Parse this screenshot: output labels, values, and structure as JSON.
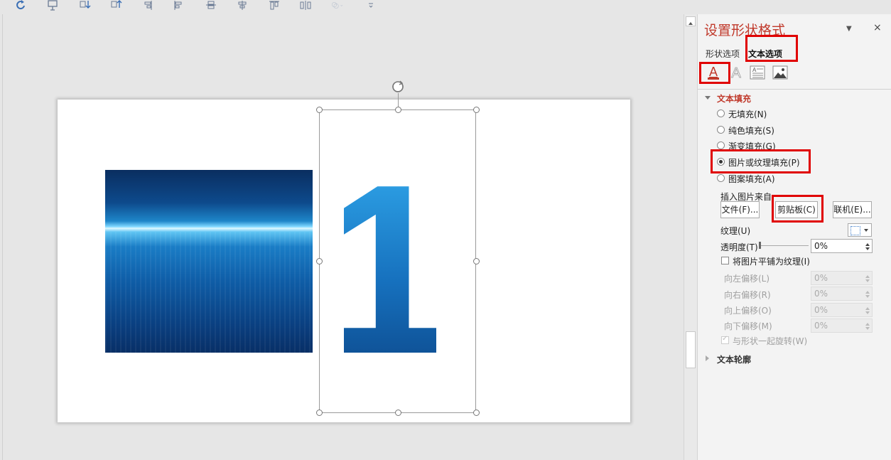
{
  "pane": {
    "title": "设置形状格式",
    "close_glyph": "×",
    "tabs": [
      "形状选项",
      "文本选项"
    ],
    "section_fill": "文本填充",
    "section_outline": "文本轮廓",
    "fill_options": [
      {
        "label": "无填充(N)",
        "selected": false
      },
      {
        "label": "纯色填充(S)",
        "selected": false
      },
      {
        "label": "渐变填充(G)",
        "selected": false
      },
      {
        "label": "图片或纹理填充(P)",
        "selected": true
      },
      {
        "label": "图案填充(A)",
        "selected": false
      }
    ],
    "insert_from_label": "插入图片来自",
    "buttons": {
      "file": "文件(F)...",
      "clipboard": "剪贴板(C)",
      "online": "联机(E)..."
    },
    "texture_label": "纹理(U)",
    "transparency_label": "透明度(T)",
    "transparency_value": "0%",
    "tile_label": "将图片平铺为纹理(I)",
    "offsets": [
      {
        "label": "向左偏移(L)",
        "value": "0%"
      },
      {
        "label": "向右偏移(R)",
        "value": "0%"
      },
      {
        "label": "向上偏移(O)",
        "value": "0%"
      },
      {
        "label": "向下偏移(M)",
        "value": "0%"
      }
    ],
    "rotate_label": "与形状一起旋转(W)"
  },
  "slide": {
    "big_text": "1",
    "photo_colors": [
      "#0a2e60",
      "#1e86c9",
      "#dff8ff",
      "#0f5ea8"
    ]
  },
  "colors": {
    "accent": "#c0392b",
    "highlight": "#e00000"
  }
}
